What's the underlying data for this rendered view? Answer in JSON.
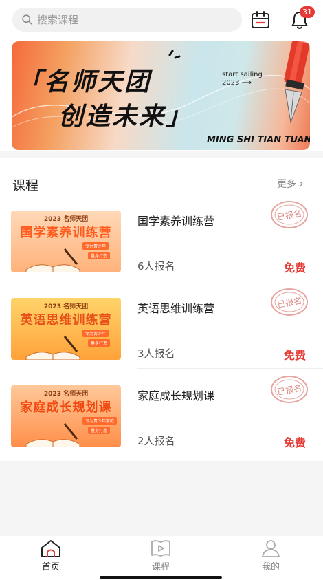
{
  "header": {
    "search_placeholder": "搜索课程",
    "notification_count": "31"
  },
  "banner": {
    "line1": "「名师天团",
    "line2": "创造未来」",
    "sail_text": "start sailing",
    "sail_year": "2023",
    "pinyin": "MING SHI TIAN TUAN"
  },
  "section": {
    "title": "课程",
    "more_label": "更多"
  },
  "courses": [
    {
      "title": "国学素养训练营",
      "count": "6人报名",
      "price": "免费",
      "stamp": "已报名",
      "thumb_year": "2023 名师天团",
      "thumb_title": "国学素养训练营",
      "thumb_tag1": "专为青少年",
      "thumb_tag2": "量身打造"
    },
    {
      "title": "英语思维训练营",
      "count": "3人报名",
      "price": "免费",
      "stamp": "已报名",
      "thumb_year": "2023 名师天团",
      "thumb_title": "英语思维训练营",
      "thumb_tag1": "专为青少年",
      "thumb_tag2": "量身打造"
    },
    {
      "title": "家庭成长规划课",
      "count": "2人报名",
      "price": "免费",
      "stamp": "已报名",
      "thumb_year": "2023 名师天团",
      "thumb_title": "家庭成长规划课",
      "thumb_tag1": "专为青少年家庭",
      "thumb_tag2": "量身打造"
    }
  ],
  "tabs": [
    {
      "label": "首页",
      "icon": "home-icon",
      "active": true
    },
    {
      "label": "课程",
      "icon": "video-book-icon",
      "active": false
    },
    {
      "label": "我的",
      "icon": "user-icon",
      "active": false
    }
  ],
  "colors": {
    "accent": "#e53935",
    "thumb_orange": "#ff5b1f"
  }
}
